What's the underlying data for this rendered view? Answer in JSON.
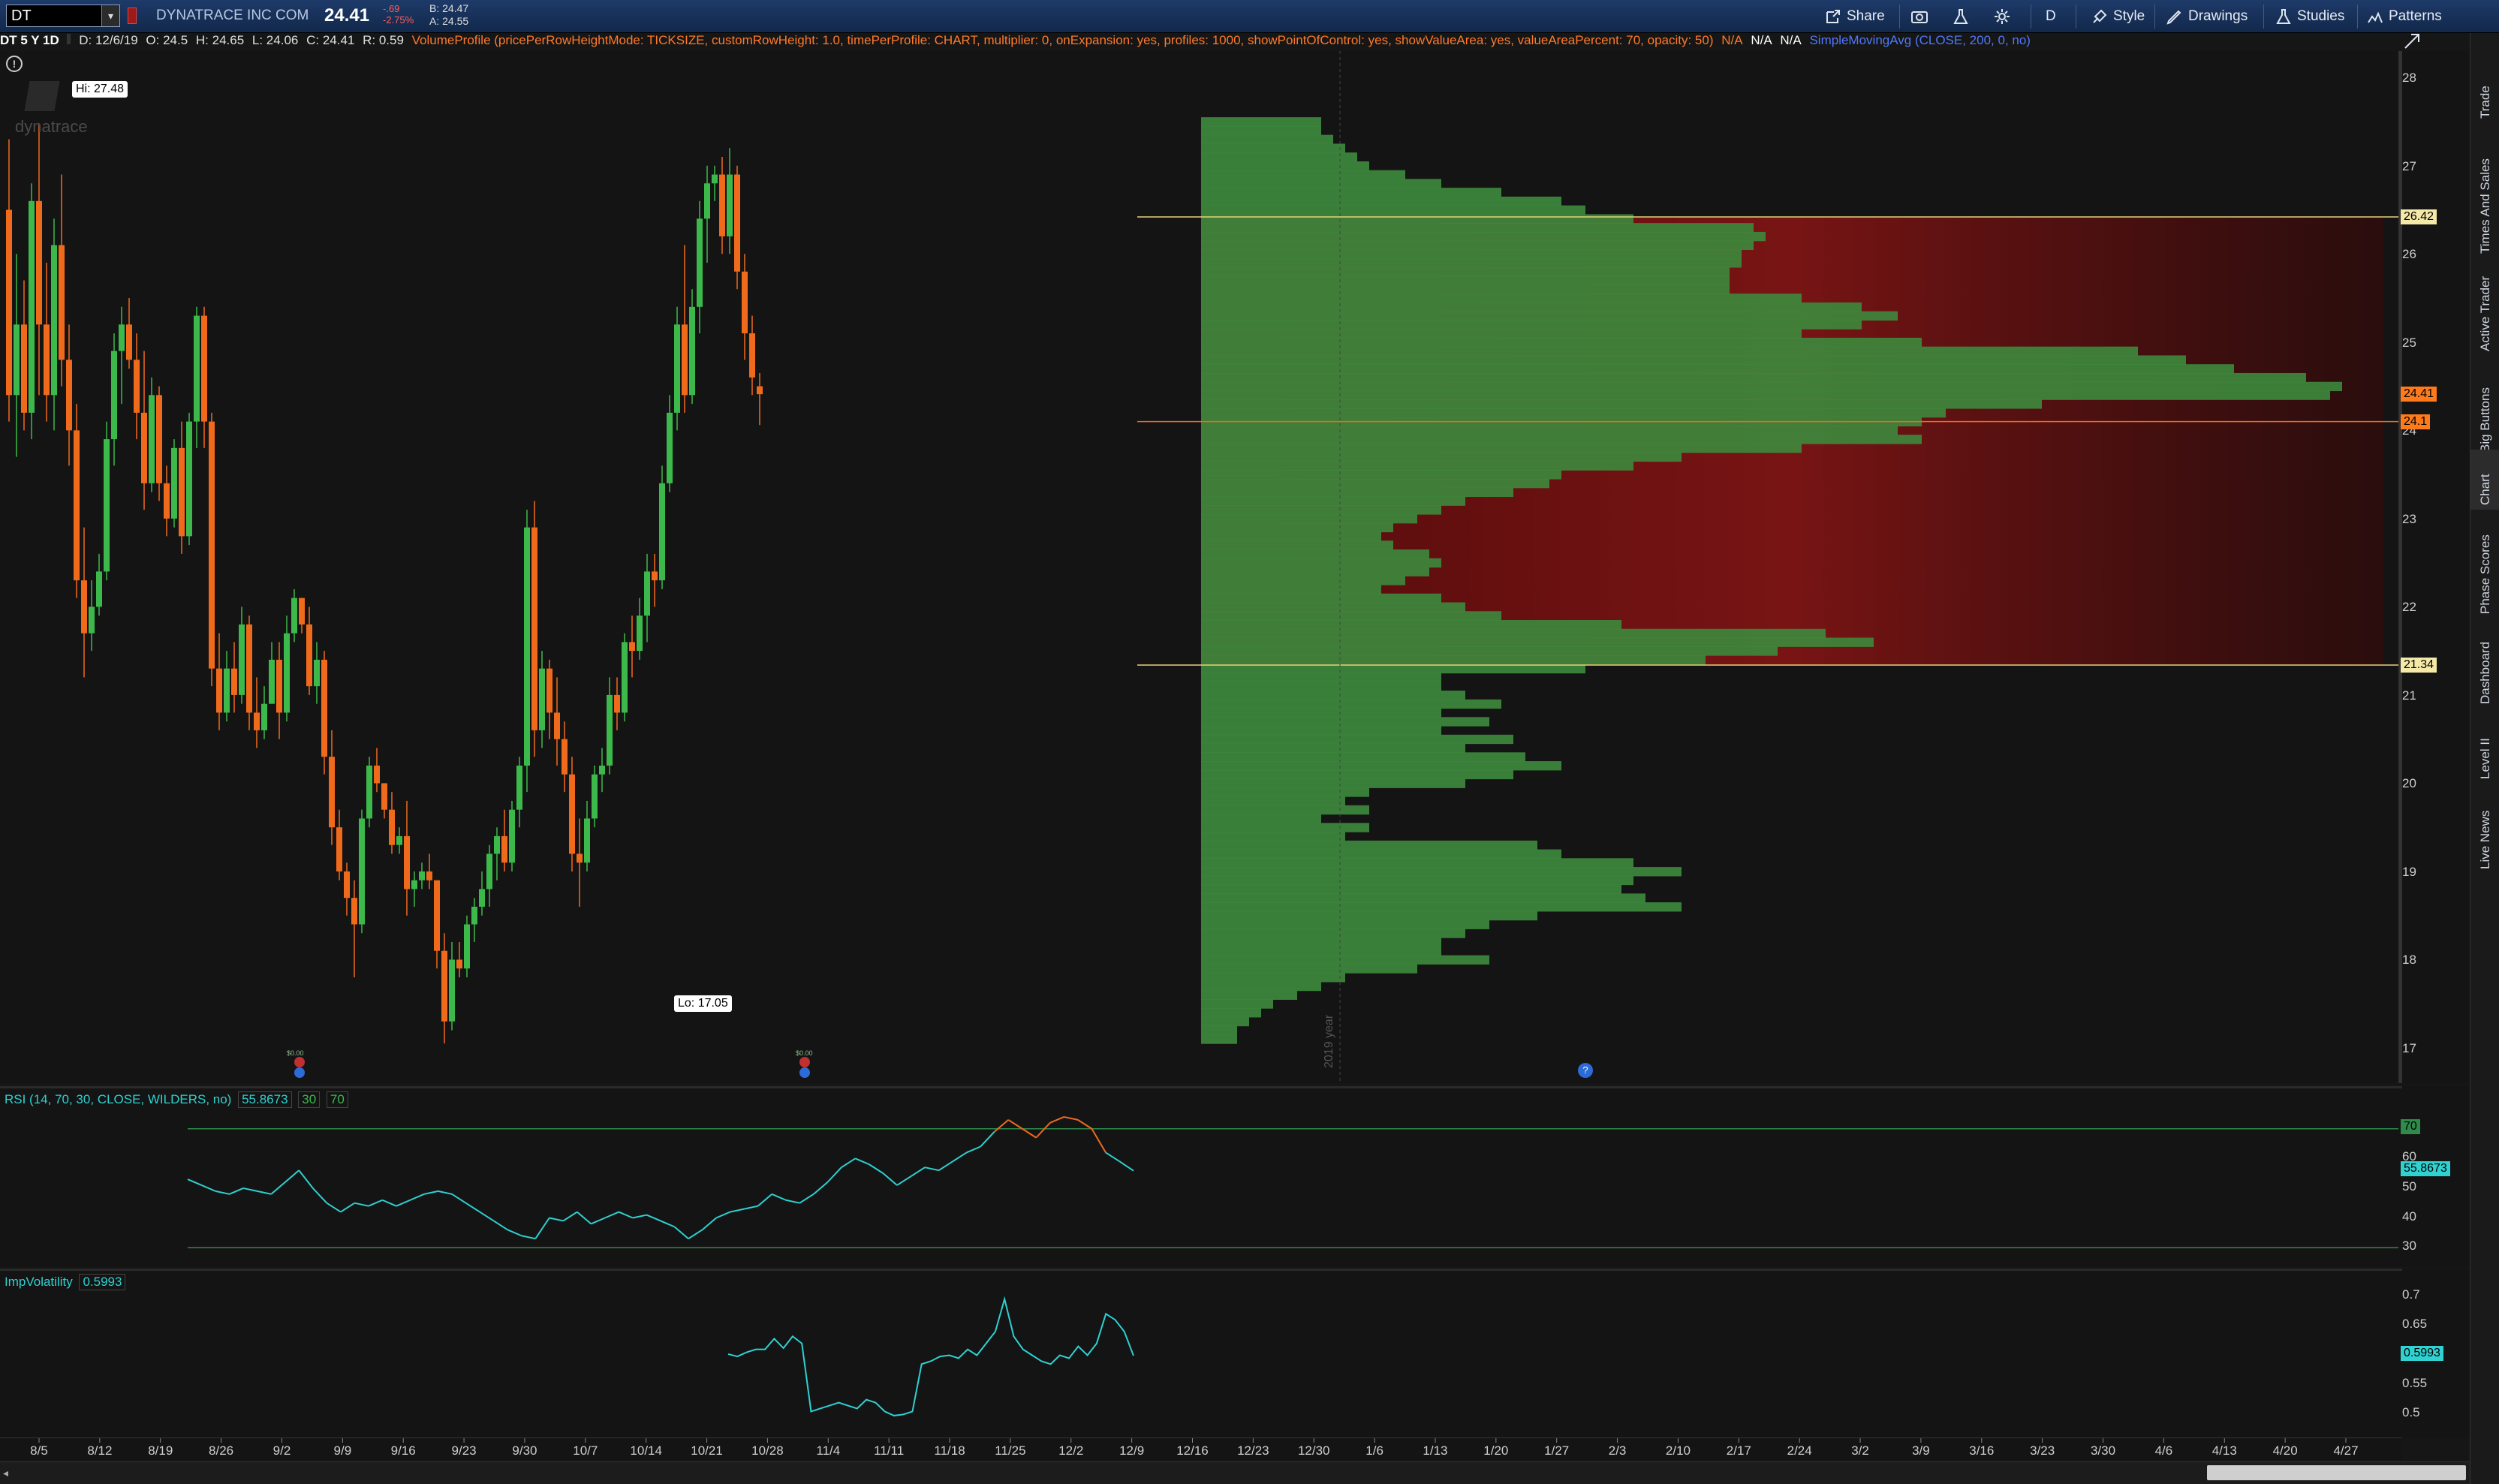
{
  "toolbar": {
    "symbol": "DT",
    "company": "DYNATRACE INC COM",
    "last": "24.41",
    "change": "-.69",
    "change_pct": "-2.75%",
    "bid": "B: 24.47",
    "ask": "A: 24.55",
    "share_label": "Share",
    "aggregation_label": "D",
    "style_label": "Style",
    "drawings_label": "Drawings",
    "studies_label": "Studies",
    "patterns_label": "Patterns"
  },
  "study_line": {
    "title": "DT 5 Y 1D",
    "date": "D: 12/6/19",
    "open": "O: 24.5",
    "high": "H: 24.65",
    "low": "L: 24.06",
    "close": "C: 24.41",
    "range": "R: 0.59",
    "volume_profile": "VolumeProfile (pricePerRowHeightMode: TICKSIZE, customRowHeight: 1.0, timePerProfile: CHART, multiplier: 0, onExpansion: yes, profiles: 1000, showPointOfControl: yes, showValueArea: yes, valueAreaPercent: 70, opacity: 50)",
    "na1": "N/A",
    "na2": "N/A",
    "na3": "N/A",
    "sma": "SimpleMovingAvg (CLOSE, 200, 0, no)"
  },
  "right_tabs": [
    "Trade",
    "Times And Sales",
    "Active Trader",
    "Big Buttons",
    "Chart",
    "Phase Scores",
    "Dashboard",
    "Level II",
    "Live News"
  ],
  "watermark": "dynatrace",
  "main_chart": {
    "hi_label": "Hi: 27.48",
    "lo_label": "Lo: 17.05",
    "year_label": "2019 year",
    "price_axis": [
      "28",
      "27",
      "26",
      "25",
      "24",
      "23",
      "22",
      "21",
      "20",
      "19",
      "18",
      "17"
    ],
    "value_area_high": "26.42",
    "value_area_low": "21.34",
    "last_price_tag": "24.41",
    "poc_tag": "24.1",
    "event_label_1": "$0.00",
    "event_label_2": "$0.00",
    "colors": {
      "up": "#3cb94a",
      "down": "#f06a1c",
      "profile": "#3d8a3d",
      "value_area": "#7a1010"
    }
  },
  "rsi": {
    "title": "RSI (14, 70, 30, CLOSE, WILDERS, no)",
    "value": "55.8673",
    "ob": "30",
    "os": "70",
    "axis": [
      "70",
      "60",
      "50",
      "40",
      "30"
    ],
    "tag_70": "70",
    "tag_value": "55.8673"
  },
  "iv": {
    "title": "ImpVolatility",
    "value": "0.5993",
    "axis": [
      "0.7",
      "0.65",
      "0.6",
      "0.55",
      "0.5"
    ],
    "tag_value": "0.5993"
  },
  "time_axis": [
    "8/5",
    "8/12",
    "8/19",
    "8/26",
    "9/2",
    "9/9",
    "9/16",
    "9/23",
    "9/30",
    "10/7",
    "10/14",
    "10/21",
    "10/28",
    "11/4",
    "11/11",
    "11/18",
    "11/25",
    "12/2",
    "12/9",
    "12/16",
    "12/23",
    "12/30",
    "1/6",
    "1/13",
    "1/20",
    "1/27",
    "2/3",
    "2/10",
    "2/17",
    "2/24",
    "3/2",
    "3/9",
    "3/16",
    "3/23",
    "3/30",
    "4/6",
    "4/13",
    "4/20",
    "4/27"
  ],
  "chart_data": {
    "type": "candlestick",
    "price_range": [
      16.6,
      28.3
    ],
    "candles": [
      [
        26.5,
        27.3,
        24.1,
        24.4
      ],
      [
        24.4,
        26.0,
        23.7,
        25.2
      ],
      [
        25.2,
        25.7,
        24.0,
        24.2
      ],
      [
        24.2,
        26.8,
        23.9,
        26.6
      ],
      [
        26.6,
        27.48,
        24.4,
        25.2
      ],
      [
        25.2,
        25.9,
        24.1,
        24.4
      ],
      [
        24.4,
        26.4,
        24.0,
        26.1
      ],
      [
        26.1,
        26.9,
        24.5,
        24.8
      ],
      [
        24.8,
        25.2,
        23.6,
        24.0
      ],
      [
        24.0,
        24.3,
        22.1,
        22.3
      ],
      [
        22.3,
        22.9,
        21.2,
        21.7
      ],
      [
        21.7,
        22.3,
        21.5,
        22.0
      ],
      [
        22.0,
        22.6,
        21.9,
        22.4
      ],
      [
        22.4,
        24.1,
        22.3,
        23.9
      ],
      [
        23.9,
        25.1,
        23.6,
        24.9
      ],
      [
        24.9,
        25.4,
        24.3,
        25.2
      ],
      [
        25.2,
        25.5,
        24.7,
        24.8
      ],
      [
        24.8,
        25.1,
        23.9,
        24.2
      ],
      [
        24.2,
        24.9,
        23.1,
        23.4
      ],
      [
        23.4,
        24.6,
        23.3,
        24.4
      ],
      [
        24.4,
        24.5,
        23.2,
        23.4
      ],
      [
        23.4,
        23.6,
        22.8,
        23.0
      ],
      [
        23.0,
        23.9,
        22.9,
        23.8
      ],
      [
        23.8,
        24.1,
        22.6,
        22.8
      ],
      [
        22.8,
        24.2,
        22.7,
        24.1
      ],
      [
        24.1,
        25.4,
        23.8,
        25.3
      ],
      [
        25.3,
        25.4,
        23.8,
        24.1
      ],
      [
        24.1,
        24.2,
        21.1,
        21.3
      ],
      [
        21.3,
        21.7,
        20.6,
        20.8
      ],
      [
        20.8,
        21.5,
        20.7,
        21.3
      ],
      [
        21.3,
        21.6,
        20.8,
        21.0
      ],
      [
        21.0,
        22.0,
        20.9,
        21.8
      ],
      [
        21.8,
        21.9,
        20.6,
        20.8
      ],
      [
        20.8,
        21.2,
        20.4,
        20.6
      ],
      [
        20.6,
        21.1,
        20.5,
        20.9
      ],
      [
        20.9,
        21.6,
        20.9,
        21.4
      ],
      [
        21.4,
        21.6,
        20.5,
        20.8
      ],
      [
        20.8,
        21.9,
        20.7,
        21.7
      ],
      [
        21.7,
        22.2,
        21.6,
        22.1
      ],
      [
        22.1,
        22.1,
        21.7,
        21.8
      ],
      [
        21.8,
        22.0,
        21.0,
        21.1
      ],
      [
        21.1,
        21.6,
        20.9,
        21.4
      ],
      [
        21.4,
        21.5,
        20.1,
        20.3
      ],
      [
        20.3,
        20.6,
        19.3,
        19.5
      ],
      [
        19.5,
        19.7,
        18.9,
        19.0
      ],
      [
        19.0,
        19.1,
        18.5,
        18.7
      ],
      [
        18.7,
        18.9,
        17.8,
        18.4
      ],
      [
        18.4,
        19.7,
        18.3,
        19.6
      ],
      [
        19.6,
        20.3,
        19.5,
        20.2
      ],
      [
        20.2,
        20.4,
        19.9,
        20.0
      ],
      [
        20.0,
        20.0,
        19.6,
        19.7
      ],
      [
        19.7,
        19.9,
        19.2,
        19.3
      ],
      [
        19.3,
        19.5,
        19.2,
        19.4
      ],
      [
        19.4,
        19.8,
        18.5,
        18.8
      ],
      [
        18.8,
        19.0,
        18.6,
        18.9
      ],
      [
        18.9,
        19.1,
        18.8,
        19.0
      ],
      [
        19.0,
        19.2,
        18.8,
        18.9
      ],
      [
        18.9,
        18.9,
        17.9,
        18.1
      ],
      [
        18.1,
        18.3,
        17.05,
        17.3
      ],
      [
        17.3,
        18.2,
        17.2,
        18.0
      ],
      [
        18.0,
        18.2,
        17.8,
        17.9
      ],
      [
        17.9,
        18.5,
        17.8,
        18.4
      ],
      [
        18.4,
        18.7,
        18.2,
        18.6
      ],
      [
        18.6,
        19.0,
        18.5,
        18.8
      ],
      [
        18.8,
        19.3,
        18.6,
        19.2
      ],
      [
        19.2,
        19.5,
        18.9,
        19.4
      ],
      [
        19.4,
        19.7,
        19.0,
        19.1
      ],
      [
        19.1,
        19.8,
        19.0,
        19.7
      ],
      [
        19.7,
        20.3,
        19.5,
        20.2
      ],
      [
        20.2,
        23.1,
        19.9,
        22.9
      ],
      [
        22.9,
        23.2,
        20.3,
        20.6
      ],
      [
        20.6,
        21.5,
        20.4,
        21.3
      ],
      [
        21.3,
        21.4,
        20.5,
        20.8
      ],
      [
        20.8,
        21.2,
        20.2,
        20.5
      ],
      [
        20.5,
        20.7,
        19.9,
        20.1
      ],
      [
        20.1,
        20.3,
        19.0,
        19.2
      ],
      [
        19.2,
        19.6,
        18.6,
        19.1
      ],
      [
        19.1,
        19.8,
        19.0,
        19.6
      ],
      [
        19.6,
        20.2,
        19.5,
        20.1
      ],
      [
        20.1,
        20.4,
        19.9,
        20.2
      ],
      [
        20.2,
        21.2,
        20.1,
        21.0
      ],
      [
        21.0,
        21.2,
        20.6,
        20.8
      ],
      [
        20.8,
        21.7,
        20.7,
        21.6
      ],
      [
        21.6,
        21.9,
        21.2,
        21.5
      ],
      [
        21.5,
        22.1,
        21.4,
        21.9
      ],
      [
        21.9,
        22.6,
        21.6,
        22.4
      ],
      [
        22.4,
        22.6,
        22.0,
        22.3
      ],
      [
        22.3,
        23.6,
        22.2,
        23.4
      ],
      [
        23.4,
        24.4,
        23.3,
        24.2
      ],
      [
        24.2,
        25.4,
        24.0,
        25.2
      ],
      [
        25.2,
        26.1,
        24.2,
        24.4
      ],
      [
        24.4,
        25.6,
        24.3,
        25.4
      ],
      [
        25.4,
        26.6,
        25.1,
        26.4
      ],
      [
        26.4,
        27.0,
        25.9,
        26.8
      ],
      [
        26.8,
        27.0,
        26.6,
        26.9
      ],
      [
        26.9,
        27.1,
        26.0,
        26.2
      ],
      [
        26.2,
        27.2,
        26.0,
        26.9
      ],
      [
        26.9,
        27.0,
        25.6,
        25.8
      ],
      [
        25.8,
        26.0,
        24.8,
        25.1
      ],
      [
        25.1,
        25.3,
        24.4,
        24.6
      ],
      [
        24.5,
        24.65,
        24.06,
        24.41
      ]
    ],
    "value_area": [
      21.34,
      26.42
    ],
    "point_of_control": 24.1,
    "volume_profile": [
      [
        27.5,
        0.1
      ],
      [
        27.4,
        0.1
      ],
      [
        27.3,
        0.11
      ],
      [
        27.2,
        0.12
      ],
      [
        27.1,
        0.13
      ],
      [
        27.0,
        0.14
      ],
      [
        26.9,
        0.17
      ],
      [
        26.8,
        0.2
      ],
      [
        26.7,
        0.25
      ],
      [
        26.6,
        0.3
      ],
      [
        26.5,
        0.32
      ],
      [
        26.4,
        0.36
      ],
      [
        26.3,
        0.46
      ],
      [
        26.2,
        0.47
      ],
      [
        26.1,
        0.46
      ],
      [
        26.0,
        0.45
      ],
      [
        25.9,
        0.45
      ],
      [
        25.8,
        0.44
      ],
      [
        25.7,
        0.44
      ],
      [
        25.6,
        0.44
      ],
      [
        25.5,
        0.5
      ],
      [
        25.4,
        0.55
      ],
      [
        25.3,
        0.58
      ],
      [
        25.2,
        0.55
      ],
      [
        25.1,
        0.5
      ],
      [
        25.0,
        0.6
      ],
      [
        24.9,
        0.78
      ],
      [
        24.8,
        0.82
      ],
      [
        24.7,
        0.86
      ],
      [
        24.6,
        0.92
      ],
      [
        24.5,
        0.95
      ],
      [
        24.4,
        0.94
      ],
      [
        24.3,
        0.7
      ],
      [
        24.2,
        0.62
      ],
      [
        24.1,
        0.6
      ],
      [
        24.0,
        0.58
      ],
      [
        23.9,
        0.6
      ],
      [
        23.8,
        0.5
      ],
      [
        23.7,
        0.4
      ],
      [
        23.6,
        0.36
      ],
      [
        23.5,
        0.3
      ],
      [
        23.4,
        0.29
      ],
      [
        23.3,
        0.26
      ],
      [
        23.2,
        0.22
      ],
      [
        23.1,
        0.2
      ],
      [
        23.0,
        0.18
      ],
      [
        22.9,
        0.16
      ],
      [
        22.8,
        0.15
      ],
      [
        22.7,
        0.16
      ],
      [
        22.6,
        0.19
      ],
      [
        22.5,
        0.2
      ],
      [
        22.4,
        0.19
      ],
      [
        22.3,
        0.17
      ],
      [
        22.2,
        0.15
      ],
      [
        22.1,
        0.2
      ],
      [
        22.0,
        0.22
      ],
      [
        21.9,
        0.25
      ],
      [
        21.8,
        0.35
      ],
      [
        21.7,
        0.52
      ],
      [
        21.6,
        0.56
      ],
      [
        21.5,
        0.48
      ],
      [
        21.4,
        0.42
      ],
      [
        21.3,
        0.32
      ],
      [
        21.2,
        0.2
      ],
      [
        21.1,
        0.2
      ],
      [
        21.0,
        0.22
      ],
      [
        20.9,
        0.25
      ],
      [
        20.8,
        0.2
      ],
      [
        20.7,
        0.24
      ],
      [
        20.6,
        0.2
      ],
      [
        20.5,
        0.26
      ],
      [
        20.4,
        0.22
      ],
      [
        20.3,
        0.27
      ],
      [
        20.2,
        0.3
      ],
      [
        20.1,
        0.26
      ],
      [
        20.0,
        0.22
      ],
      [
        19.9,
        0.14
      ],
      [
        19.8,
        0.12
      ],
      [
        19.7,
        0.14
      ],
      [
        19.6,
        0.1
      ],
      [
        19.5,
        0.14
      ],
      [
        19.4,
        0.12
      ],
      [
        19.3,
        0.28
      ],
      [
        19.2,
        0.3
      ],
      [
        19.1,
        0.36
      ],
      [
        19.0,
        0.4
      ],
      [
        18.9,
        0.36
      ],
      [
        18.8,
        0.35
      ],
      [
        18.7,
        0.37
      ],
      [
        18.6,
        0.4
      ],
      [
        18.5,
        0.28
      ],
      [
        18.4,
        0.24
      ],
      [
        18.3,
        0.22
      ],
      [
        18.2,
        0.2
      ],
      [
        18.1,
        0.2
      ],
      [
        18.0,
        0.24
      ],
      [
        17.9,
        0.18
      ],
      [
        17.8,
        0.12
      ],
      [
        17.7,
        0.1
      ],
      [
        17.6,
        0.08
      ],
      [
        17.5,
        0.06
      ],
      [
        17.4,
        0.05
      ],
      [
        17.3,
        0.04
      ],
      [
        17.2,
        0.03
      ],
      [
        17.1,
        0.03
      ]
    ],
    "rsi_series": [
      53,
      51,
      49,
      48,
      50,
      49,
      48,
      52,
      56,
      50,
      45,
      42,
      45,
      44,
      46,
      44,
      46,
      48,
      49,
      48,
      45,
      42,
      39,
      36,
      34,
      33,
      40,
      39,
      42,
      38,
      40,
      42,
      40,
      41,
      39,
      37,
      33,
      36,
      40,
      42,
      43,
      44,
      48,
      46,
      45,
      48,
      52,
      57,
      60,
      58,
      55,
      51,
      54,
      57,
      56,
      59,
      62,
      64,
      69,
      73,
      70,
      67,
      72,
      74,
      73,
      70,
      62,
      59,
      55.87
    ],
    "rsi_range": [
      28,
      76
    ],
    "iv_series": [
      0.602,
      0.598,
      0.605,
      0.61,
      0.61,
      0.628,
      0.612,
      0.632,
      0.62,
      0.505,
      0.51,
      0.515,
      0.52,
      0.515,
      0.51,
      0.525,
      0.52,
      0.505,
      0.498,
      0.5,
      0.505,
      0.585,
      0.59,
      0.598,
      0.6,
      0.595,
      0.61,
      0.6,
      0.62,
      0.64,
      0.695,
      0.632,
      0.61,
      0.6,
      0.59,
      0.585,
      0.6,
      0.595,
      0.615,
      0.6,
      0.62,
      0.67,
      0.66,
      0.64,
      0.5993
    ],
    "iv_range": [
      0.47,
      0.73
    ]
  }
}
